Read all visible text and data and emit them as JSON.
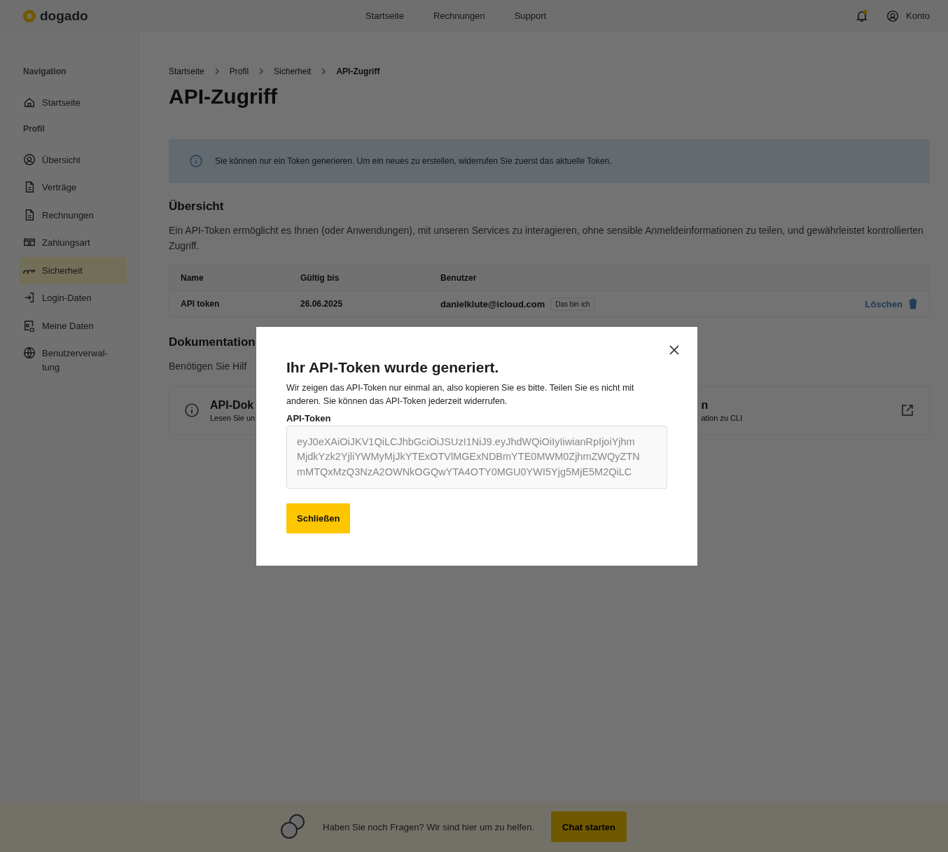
{
  "header": {
    "logo": "dogado",
    "nav": [
      {
        "label": "Startseite"
      },
      {
        "label": "Rechnungen"
      },
      {
        "label": "Support"
      }
    ],
    "account": "Konto"
  },
  "sidebar": [
    {
      "heading": "Navigation",
      "items": [
        {
          "label": "Startseite",
          "selected": false
        }
      ]
    },
    {
      "heading": "Profil",
      "items": [
        {
          "label": "Übersicht",
          "selected": false
        },
        {
          "label": "Verträge",
          "selected": false
        },
        {
          "label": "Rechnungen",
          "selected": false
        },
        {
          "label": "Zahlungsart",
          "selected": false
        },
        {
          "label": "Sicherheit",
          "selected": true
        },
        {
          "label": "Login-Daten",
          "selected": false
        },
        {
          "label": "Meine Daten",
          "selected": false
        },
        {
          "label": "Benutzerverwal-\ntung",
          "selected": false
        }
      ]
    }
  ],
  "breadcrumb": [
    "Startseite",
    "Profil",
    "Sicherheit",
    "API-Zugriff"
  ],
  "title": "API-Zugriff",
  "info": "Sie können nur ein Token generieren. Um ein neues zu erstellen, widerrufen Sie zuerst das aktuelle Token.",
  "overview": {
    "heading": "Übersicht",
    "text": "Ein API-Token ermöglicht es Ihnen (oder Anwendungen), mit unseren Services zu interagieren, ohne sensible Anmeldeinformationen zu teilen, und gewährleistet kontrollierten Zugriff."
  },
  "table": {
    "columns": [
      "Name",
      "Gültig bis",
      "Benutzer"
    ],
    "rows": [
      {
        "name": "API token",
        "valid_until": "26.06.2025",
        "user": "danielklute@icloud.com",
        "user_badge": "Das bin ich",
        "action": "Löschen"
      }
    ]
  },
  "documentation": {
    "heading": "Dokumentation",
    "text": "Benötigen Sie Hilf",
    "cards": [
      {
        "title": "API-Dok",
        "subtitle": "Lesen Sie un"
      },
      {
        "title": "n",
        "subtitle": "ation zu CLI"
      }
    ]
  },
  "chat_bar": {
    "text": "Haben Sie noch Fragen? Wir sind hier um zu helfen.",
    "button": "Chat starten"
  },
  "modal": {
    "title": "Ihr API-Token wurde generiert.",
    "text": "Wir zeigen das API-Token nur einmal an, also kopieren Sie es bitte. Teilen Sie es nicht mit anderen. Sie können das API-Token jederzeit widerrufen.",
    "field_label": "API-Token",
    "token_lines": [
      "eyJ0eXAiOiJKV1QiLCJhbGciOiJSUzI1NiJ9.eyJhdWQiOiIyIiwianRpIjoiYjhm",
      "MjdkYzk2YjliYWMyMjJkYTExOTVlMGExNDBmYTE0MWM0ZjhmZWQyZTN",
      "mMTQxMzQ3NzA2OWNkOGQwYTA4OTY0MGU0YWI5Yjg5MjE5M2QiLC"
    ],
    "button": "Schließen"
  }
}
